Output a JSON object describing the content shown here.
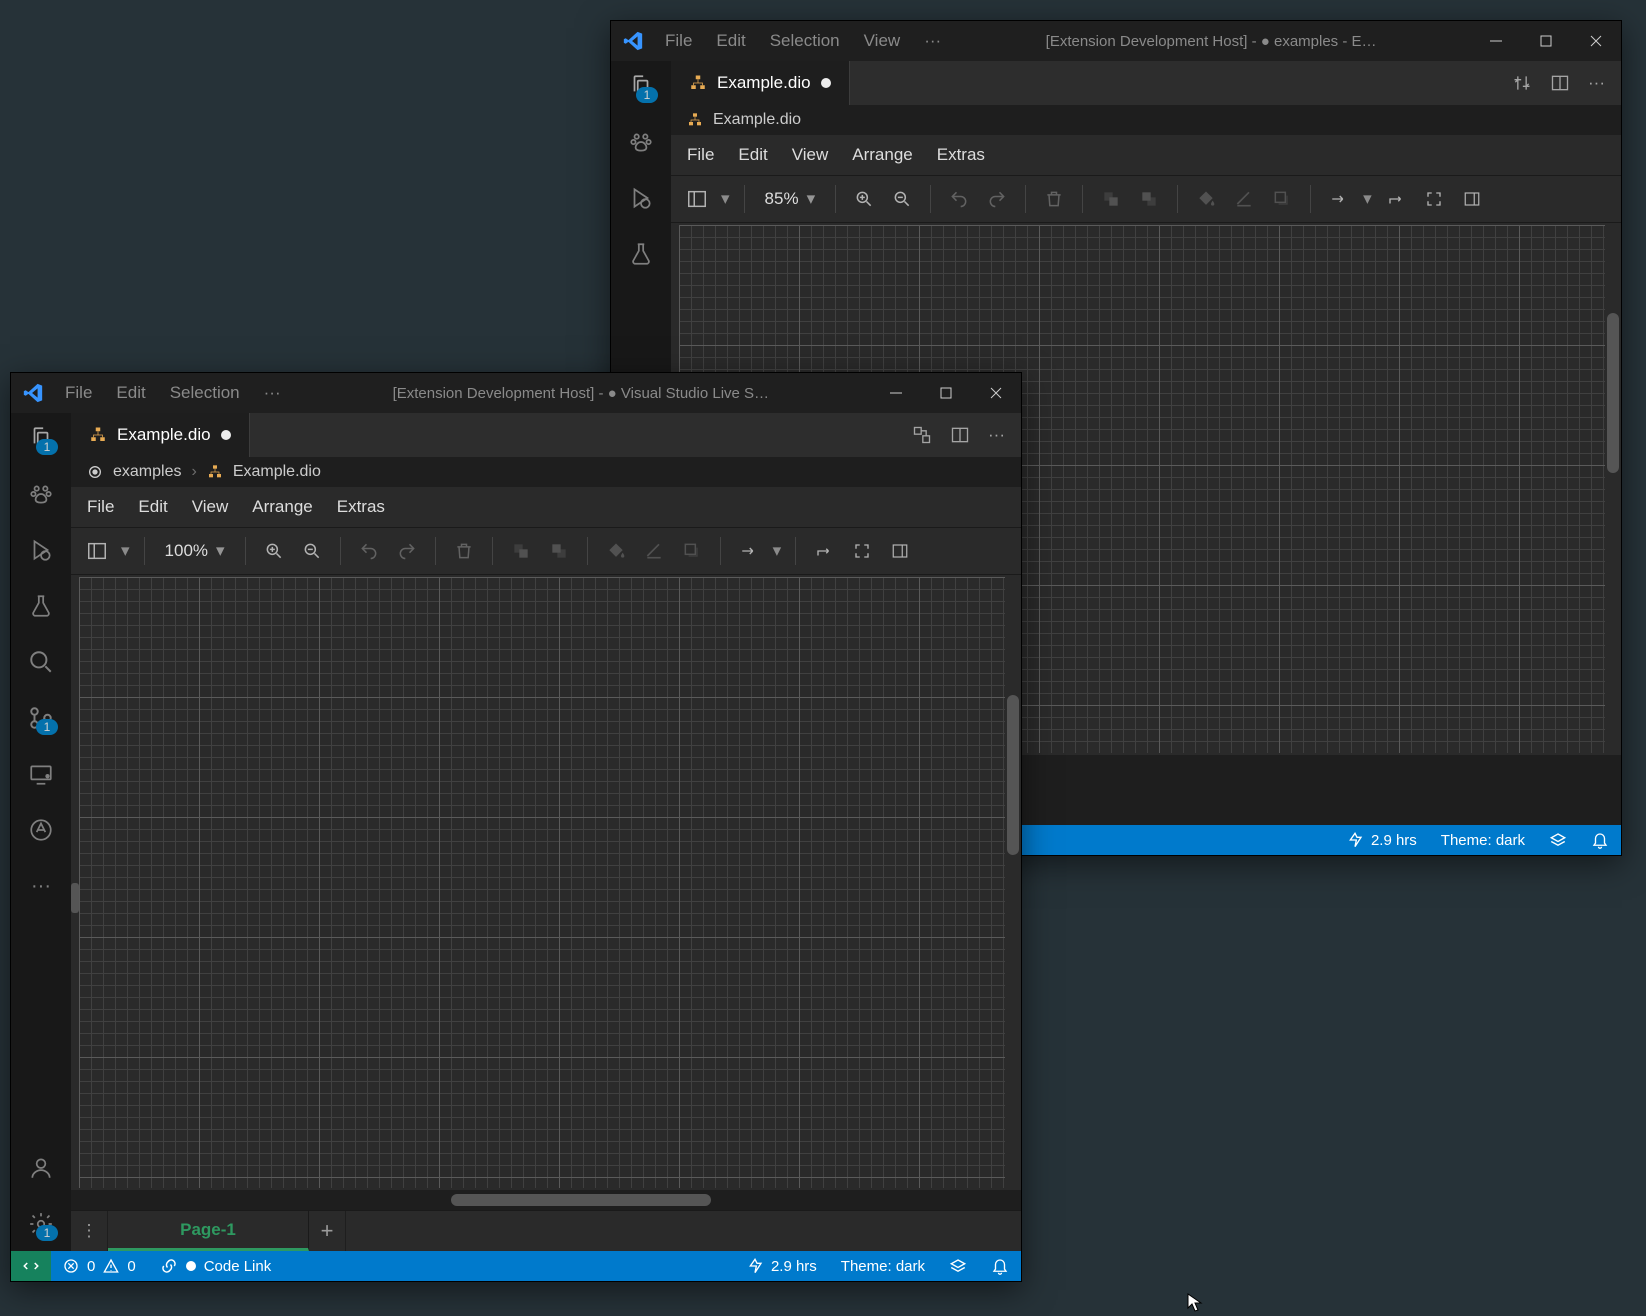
{
  "menus": {
    "file": "File",
    "edit": "Edit",
    "selection": "Selection",
    "view": "View"
  },
  "drawio_menu": {
    "file": "File",
    "edit": "Edit",
    "view": "View",
    "arrange": "Arrange",
    "extras": "Extras"
  },
  "page_tab": "Page-1",
  "status": {
    "errors": "0",
    "warnings": "0",
    "codelink": "Code Link",
    "hours": "2.9 hrs",
    "theme": "Theme: dark"
  },
  "badge_one": "1",
  "winB": {
    "title": "[Extension Development Host] - ● examples - E…",
    "tab": "Example.dio",
    "crumb": "Example.dio",
    "zoom": "85%",
    "hscroll_w": 270
  },
  "winF": {
    "title": "[Extension Development Host] - ● Visual Studio Live S…",
    "tab": "Example.dio",
    "crumb1": "examples",
    "crumb2": "Example.dio",
    "zoom": "100%",
    "hscroll_w": 260
  }
}
